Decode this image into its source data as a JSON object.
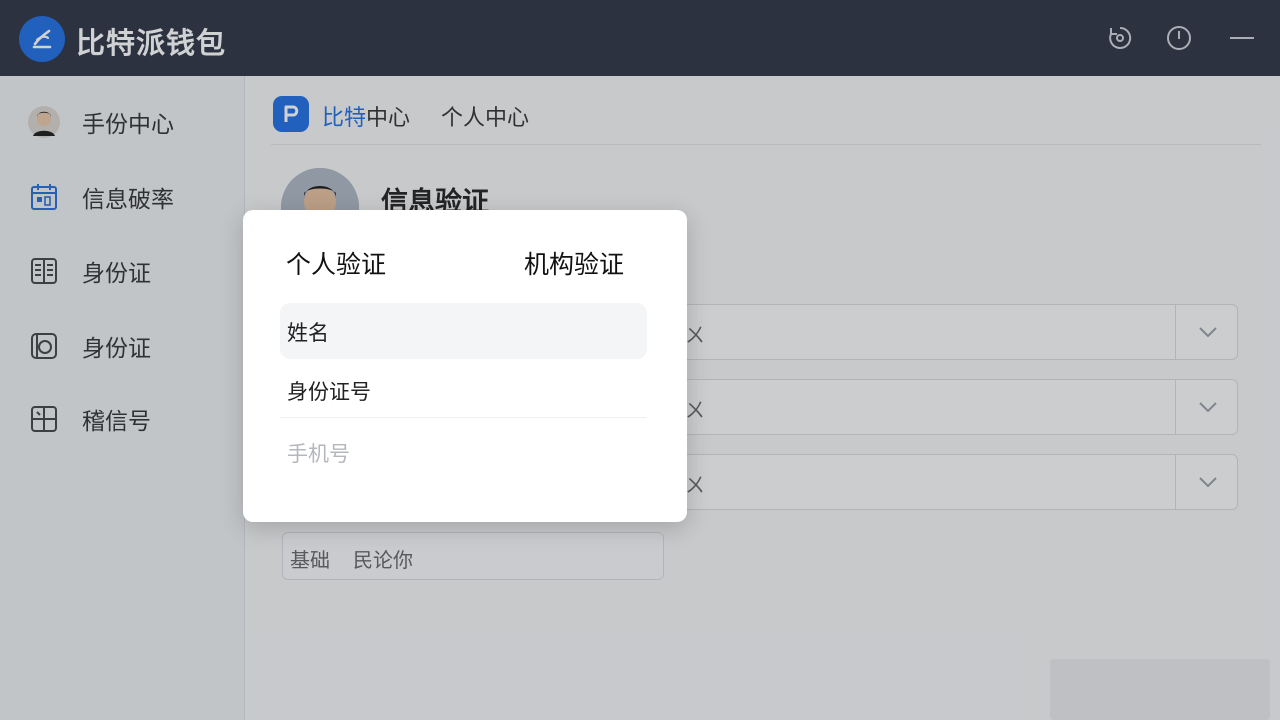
{
  "app": {
    "title": "比特派钱包",
    "brand_color": "#1f6fe5",
    "titlebar_color": "#2e3444"
  },
  "titlebar_icons": [
    "refresh-icon",
    "power-icon",
    "minimize-icon"
  ],
  "sidebar": {
    "items": [
      {
        "label": "手份中心",
        "icon": "avatar"
      },
      {
        "label": "信息破率",
        "icon": "calendar-icon"
      },
      {
        "label": "身份证",
        "icon": "id-card-icon"
      },
      {
        "label": "身份证",
        "icon": "card-reader-icon"
      },
      {
        "label": "稽信号",
        "icon": "grid-icon"
      }
    ]
  },
  "breadcrumb": {
    "first_blue": "比特",
    "first_rest": "中心",
    "second": "个人中心"
  },
  "section": {
    "title": "信息验证"
  },
  "fields": [
    {
      "value": "ㄨ"
    },
    {
      "value": "ㄨ"
    },
    {
      "value": "ㄨ"
    }
  ],
  "base_input": {
    "label": "基础",
    "value": "民论你"
  },
  "modal": {
    "tabs": [
      "个人验证",
      "机构验证"
    ],
    "options": [
      "姓名",
      "身份证号",
      "手机号"
    ]
  }
}
